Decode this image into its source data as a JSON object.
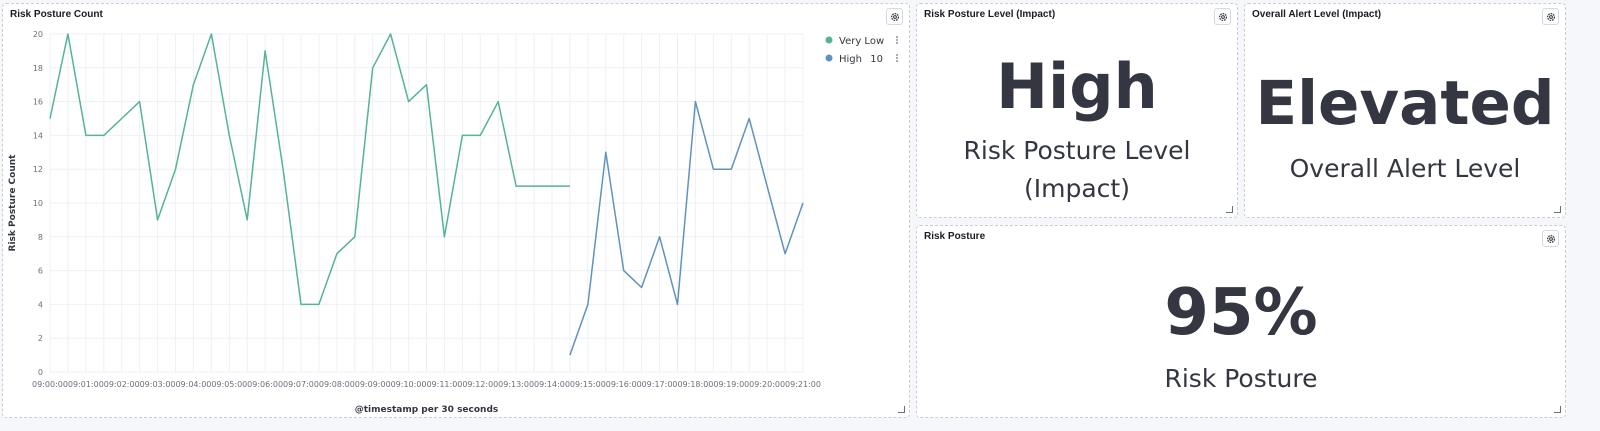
{
  "panels": {
    "chart": {
      "title": "Risk Posture Count"
    },
    "risk_level": {
      "title": "Risk Posture Level (Impact)",
      "value": "High",
      "label": "Risk Posture Level (Impact)"
    },
    "alert_level": {
      "title": "Overall Alert Level (Impact)",
      "value": "Elevated",
      "label": "Overall Alert Level"
    },
    "risk_posture": {
      "title": "Risk Posture",
      "value": "95%",
      "label": "Risk Posture"
    }
  },
  "icons": {
    "panel_menu": "gear-icon",
    "resize": "resize-handle-icon",
    "legend_menu": "vertical-dots-icon"
  },
  "colors": {
    "very_low": "#54b399",
    "high": "#6092c0"
  },
  "chart_data": {
    "type": "line",
    "title": "Risk Posture Count",
    "xlabel": "@timestamp per 30 seconds",
    "ylabel": "Risk Posture Count",
    "ylim": [
      0,
      20
    ],
    "yticks": [
      "0",
      "2",
      "4",
      "6",
      "8",
      "10",
      "12",
      "14",
      "16",
      "18",
      "20"
    ],
    "x_ticks": [
      "09:00:00",
      "09:01:00",
      "09:02:00",
      "09:03:00",
      "09:04:00",
      "09:05:00",
      "09:06:00",
      "09:07:00",
      "09:08:00",
      "09:09:00",
      "09:10:00",
      "09:11:00",
      "09:12:00",
      "09:13:00",
      "09:14:00",
      "09:15:00",
      "09:16:00",
      "09:17:00",
      "09:18:00",
      "09:19:00",
      "09:20:00",
      "09:21:00"
    ],
    "grid": true,
    "legend_position": "top-right",
    "series": [
      {
        "name": "Very Low",
        "legend_value": "",
        "color": "#54b399",
        "points": [
          [
            "09:00:00",
            15
          ],
          [
            "09:00:30",
            20
          ],
          [
            "09:01:00",
            14
          ],
          [
            "09:01:30",
            14
          ],
          [
            "09:02:00",
            15
          ],
          [
            "09:02:30",
            16
          ],
          [
            "09:03:00",
            9
          ],
          [
            "09:03:30",
            12
          ],
          [
            "09:04:00",
            17
          ],
          [
            "09:04:30",
            20
          ],
          [
            "09:05:00",
            14
          ],
          [
            "09:05:30",
            9
          ],
          [
            "09:06:00",
            19
          ],
          [
            "09:06:30",
            12
          ],
          [
            "09:07:00",
            4
          ],
          [
            "09:07:30",
            4
          ],
          [
            "09:08:00",
            7
          ],
          [
            "09:08:30",
            8
          ],
          [
            "09:09:00",
            18
          ],
          [
            "09:09:30",
            20
          ],
          [
            "09:10:00",
            16
          ],
          [
            "09:10:30",
            17
          ],
          [
            "09:11:00",
            8
          ],
          [
            "09:11:30",
            14
          ],
          [
            "09:12:00",
            14
          ],
          [
            "09:12:30",
            16
          ],
          [
            "09:13:00",
            11
          ],
          [
            "09:13:30",
            11
          ],
          [
            "09:14:00",
            11
          ],
          [
            "09:14:30",
            11
          ]
        ]
      },
      {
        "name": "High",
        "legend_value": "10",
        "color": "#6092c0",
        "points": [
          [
            "09:14:30",
            1
          ],
          [
            "09:15:00",
            4
          ],
          [
            "09:15:30",
            13
          ],
          [
            "09:16:00",
            6
          ],
          [
            "09:16:30",
            5
          ],
          [
            "09:17:00",
            8
          ],
          [
            "09:17:30",
            4
          ],
          [
            "09:18:00",
            16
          ],
          [
            "09:18:30",
            12
          ],
          [
            "09:19:00",
            12
          ],
          [
            "09:19:30",
            15
          ],
          [
            "09:20:00",
            11
          ],
          [
            "09:20:30",
            7
          ],
          [
            "09:21:00",
            10
          ]
        ]
      }
    ]
  }
}
